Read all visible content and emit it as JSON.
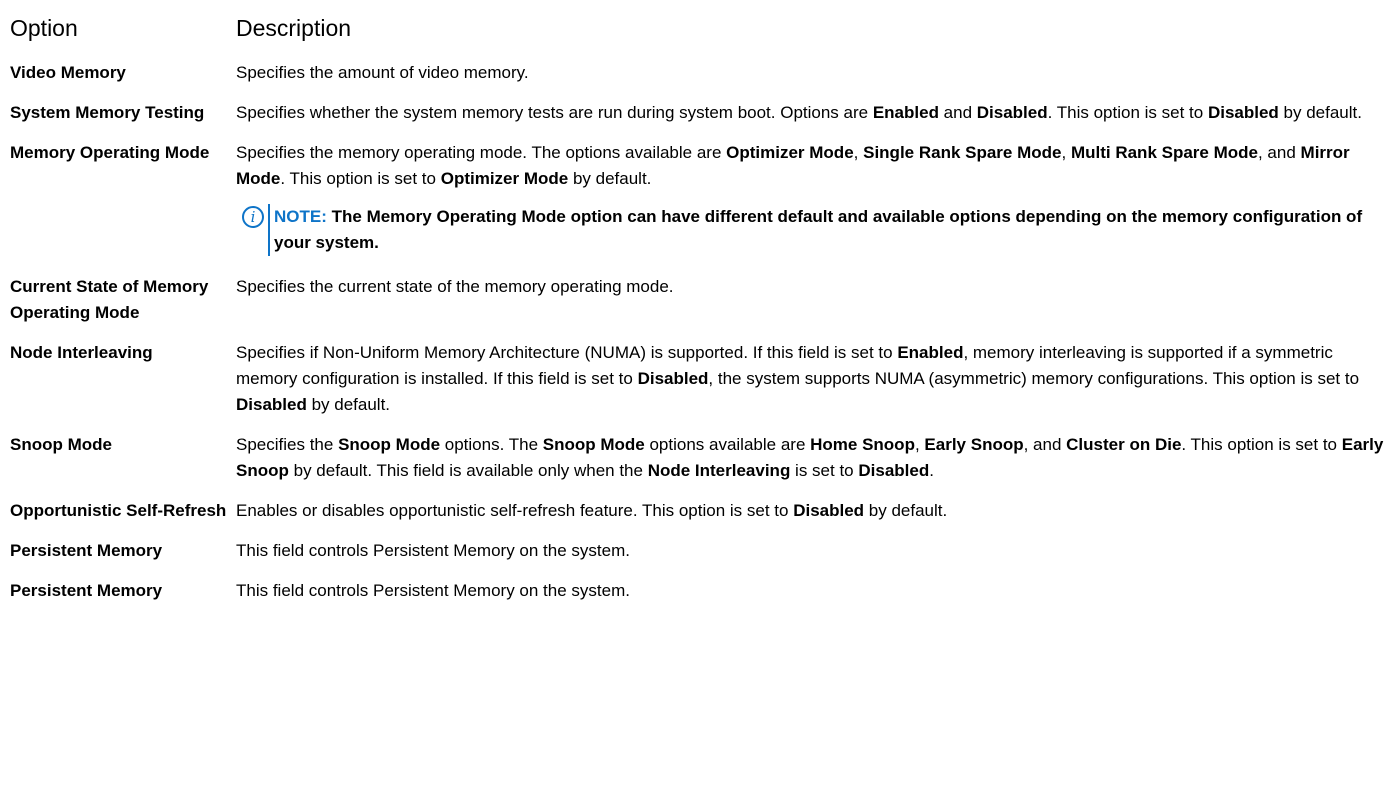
{
  "header": {
    "option": "Option",
    "description": "Description"
  },
  "rows": [
    {
      "option": "Video Memory",
      "description": [
        {
          "t": "Specifies the amount of video memory.",
          "b": false
        }
      ]
    },
    {
      "option": "System Memory Testing",
      "description": [
        {
          "t": "Specifies whether the system memory tests are run during system boot. Options are ",
          "b": false
        },
        {
          "t": "Enabled",
          "b": true
        },
        {
          "t": " and ",
          "b": false
        },
        {
          "t": "Disabled",
          "b": true
        },
        {
          "t": ". This option is set to ",
          "b": false
        },
        {
          "t": "Disabled",
          "b": true
        },
        {
          "t": " by default.",
          "b": false
        }
      ]
    },
    {
      "option": "Memory Operating Mode",
      "description": [
        {
          "t": "Specifies the memory operating mode. The options available are ",
          "b": false
        },
        {
          "t": "Optimizer Mode",
          "b": true
        },
        {
          "t": ", ",
          "b": false
        },
        {
          "t": "Single Rank Spare Mode",
          "b": true
        },
        {
          "t": ", ",
          "b": false
        },
        {
          "t": "Multi Rank Spare Mode",
          "b": true
        },
        {
          "t": ", and ",
          "b": false
        },
        {
          "t": "Mirror Mode",
          "b": true
        },
        {
          "t": ". This option is set to ",
          "b": false
        },
        {
          "t": "Optimizer Mode",
          "b": true
        },
        {
          "t": " by default.",
          "b": false
        }
      ],
      "note": {
        "label": "NOTE:",
        "text": "The Memory Operating Mode option can have different default and available options depending on the memory configuration of your system."
      }
    },
    {
      "option": "Current State of Memory Operating Mode",
      "description": [
        {
          "t": "Specifies the current state of the memory operating mode.",
          "b": false
        }
      ]
    },
    {
      "option": "Node Interleaving",
      "description": [
        {
          "t": "Specifies if Non-Uniform Memory Architecture (NUMA) is supported. If this field is set to ",
          "b": false
        },
        {
          "t": "Enabled",
          "b": true
        },
        {
          "t": ", memory interleaving is supported if a symmetric memory configuration is installed. If this field is set to ",
          "b": false
        },
        {
          "t": "Disabled",
          "b": true
        },
        {
          "t": ", the system supports NUMA (asymmetric) memory configurations. This option is set to ",
          "b": false
        },
        {
          "t": "Disabled",
          "b": true
        },
        {
          "t": " by default.",
          "b": false
        }
      ]
    },
    {
      "option": "Snoop Mode",
      "description": [
        {
          "t": "Specifies the ",
          "b": false
        },
        {
          "t": "Snoop Mode",
          "b": true
        },
        {
          "t": " options. The ",
          "b": false
        },
        {
          "t": "Snoop Mode",
          "b": true
        },
        {
          "t": " options available are ",
          "b": false
        },
        {
          "t": "Home Snoop",
          "b": true
        },
        {
          "t": ", ",
          "b": false
        },
        {
          "t": "Early Snoop",
          "b": true
        },
        {
          "t": ", and ",
          "b": false
        },
        {
          "t": "Cluster on Die",
          "b": true
        },
        {
          "t": ". This option is set to ",
          "b": false
        },
        {
          "t": "Early Snoop",
          "b": true
        },
        {
          "t": " by default. This field is available only when the ",
          "b": false
        },
        {
          "t": "Node Interleaving",
          "b": true
        },
        {
          "t": " is set to ",
          "b": false
        },
        {
          "t": "Disabled",
          "b": true
        },
        {
          "t": ".",
          "b": false
        }
      ]
    },
    {
      "option": "Opportunistic Self-Refresh",
      "description": [
        {
          "t": "Enables or disables opportunistic self-refresh feature. This option is set to ",
          "b": false
        },
        {
          "t": "Disabled",
          "b": true
        },
        {
          "t": " by default.",
          "b": false
        }
      ]
    },
    {
      "option": "Persistent Memory",
      "description": [
        {
          "t": "This field controls Persistent Memory on the system.",
          "b": false
        }
      ]
    },
    {
      "option": "Persistent Memory",
      "description": [
        {
          "t": "This field controls Persistent Memory on the system.",
          "b": false
        }
      ]
    }
  ],
  "colors": {
    "note_accent": "#0e74c8",
    "text": "#000000",
    "background": "#ffffff"
  },
  "icons": {
    "note": "info-circle-icon",
    "note_glyph": "i"
  }
}
